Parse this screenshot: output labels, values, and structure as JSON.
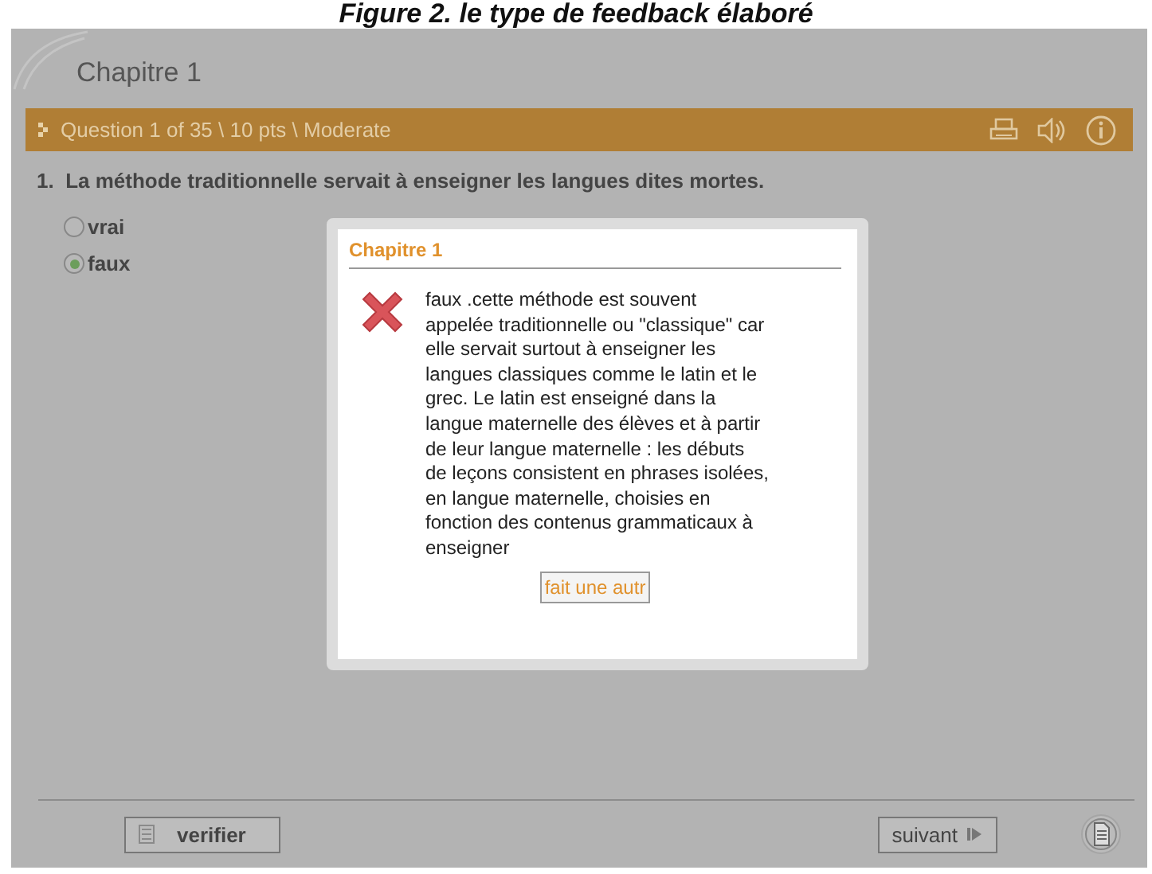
{
  "caption": "Figure 2. le type de feedback élaboré",
  "chapter_title": "Chapitre 1",
  "question_bar": {
    "text": "Question 1 of 35 \\ 10 pts \\ Moderate"
  },
  "question": {
    "number": "1.",
    "text": "La méthode traditionnelle servait à enseigner les langues dites mortes."
  },
  "options": [
    {
      "label": "vrai",
      "selected": false
    },
    {
      "label": "faux",
      "selected": true
    }
  ],
  "dialog": {
    "title": "Chapitre 1",
    "correct": false,
    "message": "faux .cette méthode est souvent appelée traditionnelle ou \"classique\" car elle servait surtout à enseigner les langues classiques comme le latin et le grec. Le latin est enseigné dans la langue maternelle des élèves et à partir de leur langue maternelle : les débuts de leçons consistent en phrases isolées, en langue maternelle, choisies en fonction des contenus grammaticaux à enseigner",
    "button": "fait une autr"
  },
  "footer": {
    "check_button": "verifier",
    "next_button": "suivant"
  }
}
